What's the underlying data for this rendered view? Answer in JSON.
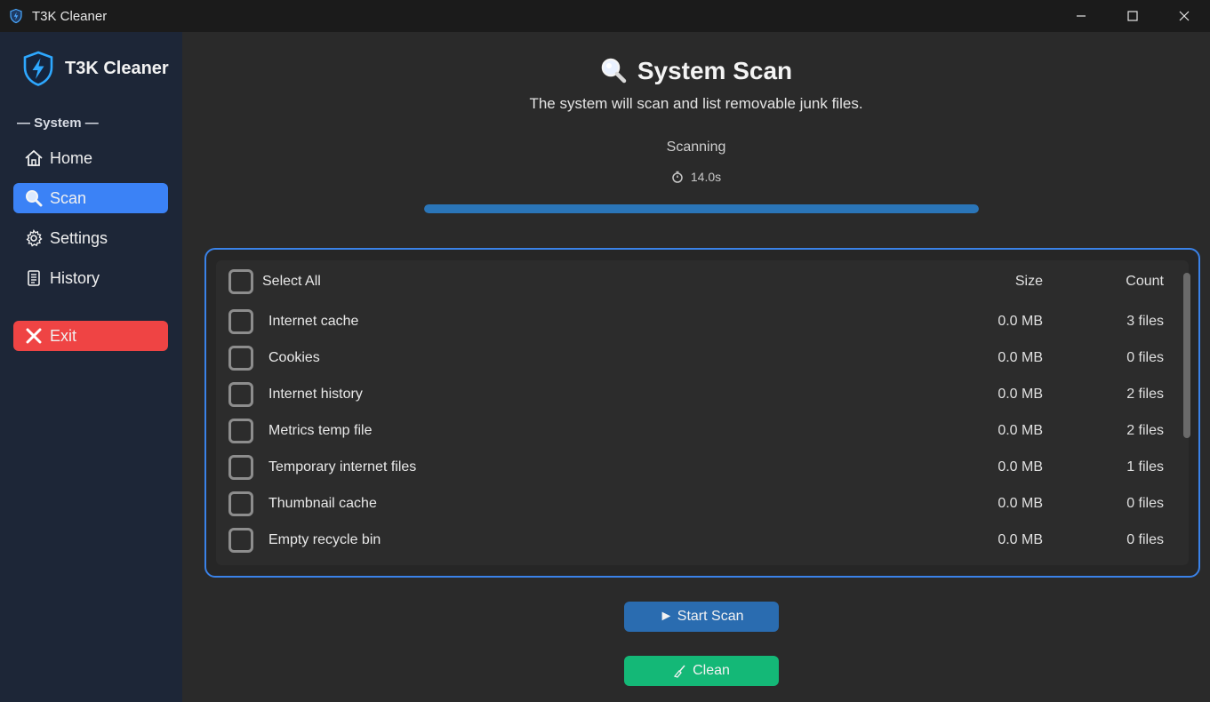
{
  "window": {
    "title": "T3K Cleaner"
  },
  "sidebar": {
    "brand": "T3K Cleaner",
    "section": "— System —",
    "items": [
      {
        "label": "Home",
        "icon": "home-icon",
        "active": false
      },
      {
        "label": "Scan",
        "icon": "magnifier-icon",
        "active": true
      },
      {
        "label": "Settings",
        "icon": "gear-icon",
        "active": false
      },
      {
        "label": "History",
        "icon": "scroll-icon",
        "active": false
      }
    ],
    "exit_label": "Exit"
  },
  "main": {
    "title": "System Scan",
    "subtitle": "The system will scan and list removable junk files.",
    "status": "Scanning",
    "timer": "14.0s",
    "progress": 1.0,
    "list": {
      "select_all": "Select All",
      "size_header": "Size",
      "count_header": "Count",
      "rows": [
        {
          "label": "Internet cache",
          "size": "0.0 MB",
          "count": "3 files"
        },
        {
          "label": "Cookies",
          "size": "0.0 MB",
          "count": "0 files"
        },
        {
          "label": "Internet history",
          "size": "0.0 MB",
          "count": "2 files"
        },
        {
          "label": "Metrics temp file",
          "size": "0.0 MB",
          "count": "2 files"
        },
        {
          "label": "Temporary internet files",
          "size": "0.0 MB",
          "count": "1 files"
        },
        {
          "label": "Thumbnail cache",
          "size": "0.0 MB",
          "count": "0 files"
        },
        {
          "label": "Empty recycle bin",
          "size": "0.0 MB",
          "count": "0 files"
        }
      ]
    },
    "start_scan_label": "► Start Scan",
    "clean_label": "Clean"
  },
  "colors": {
    "accent": "#3b82f6",
    "exit": "#ef4444",
    "clean": "#14b877",
    "scan_button": "#2a6cb0",
    "progress": "#2a75b8"
  }
}
